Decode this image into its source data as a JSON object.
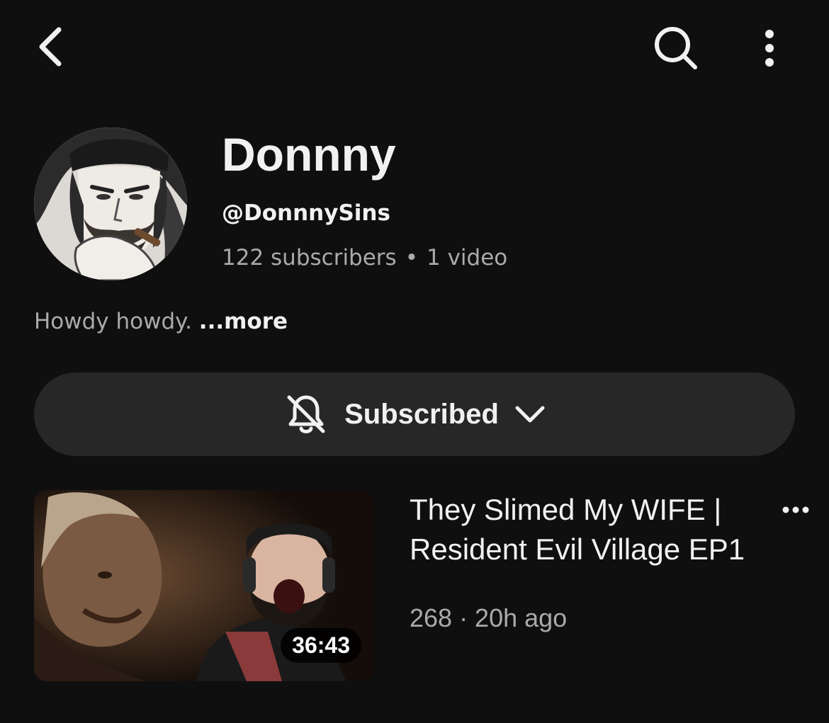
{
  "header": {
    "back_icon": "chevron-left-icon",
    "search_icon": "search-icon",
    "more_icon": "more-vert-icon"
  },
  "channel": {
    "name": "Donnny",
    "handle": "@DonnnySins",
    "subscribers": "122 subscribers",
    "separator": "•",
    "videos": "1 video",
    "description": "Howdy howdy.",
    "more_label": "...more"
  },
  "subscribe": {
    "label": "Subscribed",
    "bell_icon": "bell-off-icon",
    "chevron_icon": "chevron-down-icon"
  },
  "videos": [
    {
      "title": "They Slimed My WIFE | Resident Evil Village EP1",
      "meta": "268 · 20h ago",
      "duration": "36:43",
      "menu_icon": "more-horiz-icon"
    }
  ],
  "colors": {
    "background": "#0f0f0f",
    "button_bg": "#272727",
    "primary_text": "#f1f1f1",
    "secondary_text": "#aaaaaa"
  }
}
